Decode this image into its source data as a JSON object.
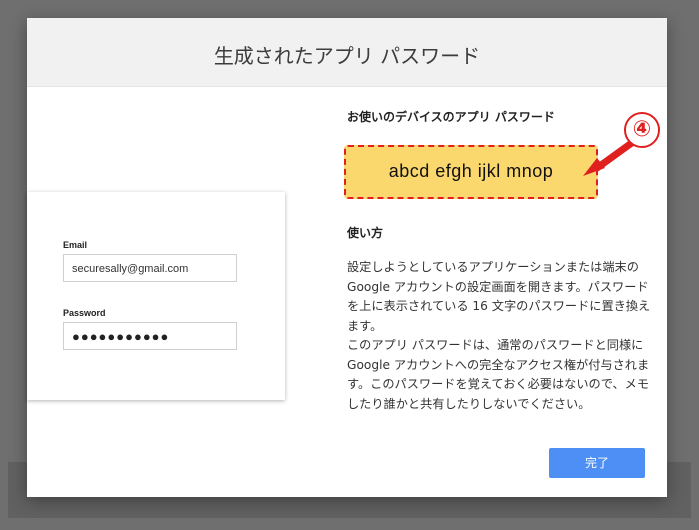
{
  "dialog": {
    "title": "生成されたアプリ パスワード"
  },
  "login_preview": {
    "email_label": "Email",
    "email_value": "securesally@gmail.com",
    "password_label": "Password",
    "password_value": "●●●●●●●●●●●"
  },
  "app_password": {
    "heading": "お使いのデバイスのアプリ パスワード",
    "value": "abcd efgh ijkl mnop"
  },
  "usage": {
    "heading": "使い方",
    "paragraph_1": "設定しようとしているアプリケーションまたは端末の Google アカウントの設定画面を開きます。パスワードを上に表示されている 16 文字のパスワードに置き換えます。",
    "paragraph_2": "このアプリ パスワードは、通常のパスワードと同様に Google アカウントへの完全なアクセス権が付与されます。このパスワードを覚えておく必要はないので、メモしたり誰かと共有したりしないでください。"
  },
  "actions": {
    "done_label": "完了"
  },
  "annotation": {
    "step_number": "④",
    "accent_color": "#e0201f",
    "highlight_color": "#fbd86d"
  }
}
